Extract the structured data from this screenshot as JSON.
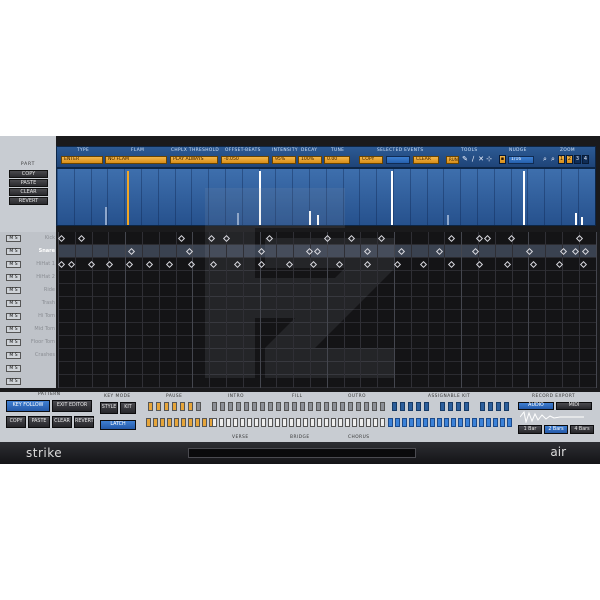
{
  "brand": "strike",
  "vendor": "air",
  "part": {
    "title": "PART",
    "buttons": [
      "COPY",
      "PASTE",
      "CLEAR",
      "REVERT"
    ]
  },
  "params": {
    "type": {
      "label": "TYPE",
      "value": "ENTER"
    },
    "flam": {
      "label": "FLAM",
      "value": "NO FLAM"
    },
    "chplx": {
      "label": "CHPLX THRESHOLD",
      "value": "PLAY ALWAYS"
    },
    "offset": {
      "label": "OFFSET-BEATS",
      "value": "-0.050"
    },
    "intensity": {
      "label": "INTENSITY",
      "value": "95%"
    },
    "decay": {
      "label": "DECAY",
      "value": "100%"
    },
    "tune": {
      "label": "TUNE",
      "value": "0.00"
    },
    "selected": {
      "label": "SELECTED EVENTS",
      "copy": "COPY",
      "clear": "CLEAR"
    },
    "tools": {
      "label": "TOOLS",
      "run": "RUN"
    },
    "nudge": {
      "label": "NUDGE",
      "value": "1/16"
    },
    "zoom": {
      "label": "ZOOM",
      "buttons": [
        "1",
        "2",
        "3",
        "4"
      ]
    }
  },
  "rows": [
    {
      "name": "Kick",
      "ms": "M S"
    },
    {
      "name": "Snare",
      "ms": "M S"
    },
    {
      "name": "HiHat 1",
      "ms": "M S"
    },
    {
      "name": "HiHat 2",
      "ms": "M S"
    },
    {
      "name": "Ride",
      "ms": "M S"
    },
    {
      "name": "Trash",
      "ms": "M S"
    },
    {
      "name": "Hi Tom",
      "ms": "M S"
    },
    {
      "name": "Mid Tom",
      "ms": "M S"
    },
    {
      "name": "Floor Tom",
      "ms": "M S"
    },
    {
      "name": "Crashes",
      "ms": "M S"
    },
    {
      "name": "",
      "ms": "M S"
    },
    {
      "name": "",
      "ms": "M S"
    }
  ],
  "pattern": {
    "title": "PATTERN",
    "key_follow": "KEY FOLLOW",
    "exit_editor": "EXIT EDITOR",
    "copy": "COPY",
    "paste": "PASTE",
    "clear": "CLEAR",
    "revert": "REVERT",
    "key_mode": {
      "label": "KEY MODE",
      "style": "STYLE",
      "kit": "KIT",
      "latch": "LATCH"
    },
    "sections_top": [
      "PAUSE",
      "INTRO",
      "FILL",
      "OUTRO",
      "ASSIGNABLE KIT"
    ],
    "sections_bottom": [
      "VERSE",
      "BRIDGE",
      "CHORUS"
    ],
    "record_export": {
      "label": "RECORD EXPORT",
      "audio": "AUDIO",
      "midi": "MIDI",
      "bars": [
        "1 Bar",
        "2 Bars",
        "4 Bars"
      ]
    }
  }
}
